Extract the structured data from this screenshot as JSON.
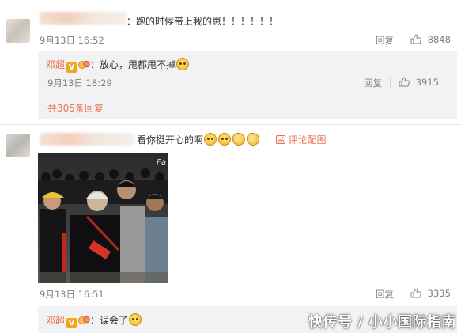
{
  "comment1": {
    "text": "：跑的时候带上我的崽！！！！！！",
    "date": "9月13日 16:52",
    "reply_label": "回复",
    "like_count": "8848",
    "reply": {
      "author": "邓超",
      "verified_badge": "V",
      "text": "：放心，甩都甩不掉",
      "date": "9月13日 18:29",
      "reply_label": "回复",
      "like_count": "3915"
    },
    "more_replies": "共305条回复"
  },
  "comment2": {
    "text": "看你挺开心的啊",
    "pic_link": "评论配图",
    "photo_sign_text": "Fa",
    "date": "9月13日 16:51",
    "reply_label": "回复",
    "like_count": "3335",
    "reply": {
      "author": "邓超",
      "verified_badge": "V",
      "text": "：误会了"
    }
  },
  "watermark": "快传号 / 小小国际指南",
  "icons": {
    "like": "thumbs-up-icon",
    "emoji": "doge-emoji-icon",
    "image": "image-icon",
    "badge": "verified-v-icon",
    "medal": "fan-medal-icon"
  },
  "colors": {
    "accent": "#eb7350",
    "meta": "#808080",
    "reply_bg": "#f2f2f5",
    "badge": "#f1a61d"
  }
}
